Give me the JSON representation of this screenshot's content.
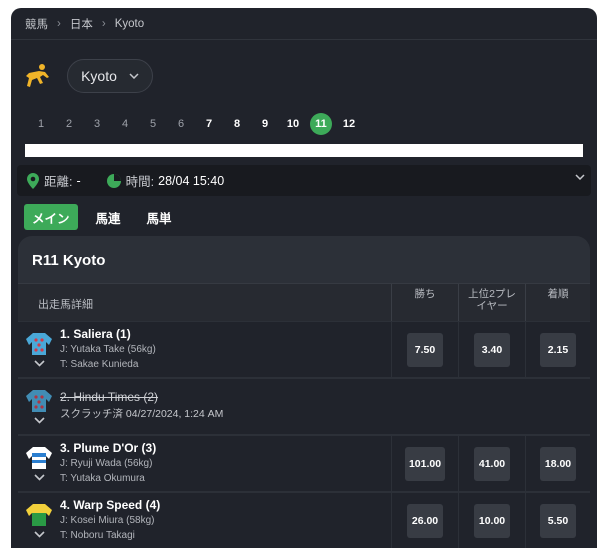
{
  "breadcrumb": {
    "items": [
      "競馬",
      "日本",
      "Kyoto"
    ]
  },
  "track": {
    "selected": "Kyoto"
  },
  "race_numbers": [
    "1",
    "2",
    "3",
    "4",
    "5",
    "6",
    "7",
    "8",
    "9",
    "10",
    "11",
    "12"
  ],
  "active_race": "11",
  "info": {
    "distance_label": "距離:",
    "distance_value": "-",
    "time_label": "時間:",
    "time_value": "28/04 15:40"
  },
  "tabs": [
    "メイン",
    "馬連",
    "馬単"
  ],
  "race": {
    "title": "R11 Kyoto",
    "columns": {
      "runner": "出走馬詳細",
      "win": "勝ち",
      "top2": "上位2プレイヤー",
      "place": "着順"
    },
    "runners": [
      {
        "name": "1. Saliera (1)",
        "jockey": "J: Yutaka Take (56kg)",
        "trainer": "T: Sakae Kunieda",
        "win": "7.50",
        "top2": "3.40",
        "place": "2.15",
        "scratched": false
      },
      {
        "name": "2. Hindu Times (2)",
        "scratch_text": "スクラッチ済 04/27/2024, 1:24 AM",
        "scratched": true
      },
      {
        "name": "3. Plume D'Or (3)",
        "jockey": "J: Ryuji Wada (56kg)",
        "trainer": "T: Yutaka Okumura",
        "win": "101.00",
        "top2": "41.00",
        "place": "18.00",
        "scratched": false
      },
      {
        "name": "4. Warp Speed (4)",
        "jockey": "J: Kosei Miura (58kg)",
        "trainer": "T: Noboru Takagi",
        "win": "26.00",
        "top2": "10.00",
        "place": "5.50",
        "scratched": false
      }
    ]
  },
  "colors": {
    "accent": "#3daa59",
    "background": "#20232b",
    "card": "#2c3038",
    "sport_icon": "#f0b429"
  }
}
